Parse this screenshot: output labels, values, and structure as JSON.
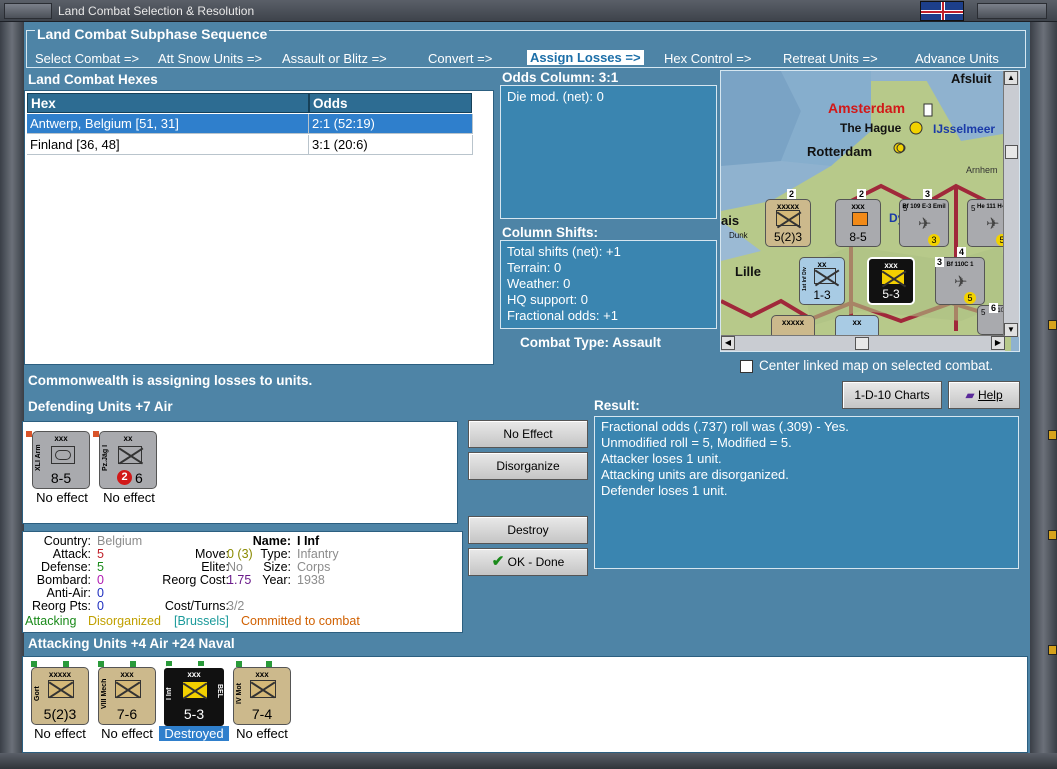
{
  "window": {
    "title": "Land Combat Selection & Resolution"
  },
  "subphase": {
    "label": "Land Combat Subphase Sequence",
    "steps": [
      {
        "label": "Select Combat =>"
      },
      {
        "label": "Att Snow Units =>"
      },
      {
        "label": "Assault or Blitz =>"
      },
      {
        "label": "Convert =>"
      },
      {
        "label": "Assign Losses =>",
        "active": true
      },
      {
        "label": "Hex Control =>"
      },
      {
        "label": "Retreat Units =>"
      },
      {
        "label": "Advance Units"
      }
    ]
  },
  "hexes": {
    "label": "Land Combat Hexes",
    "columns": [
      "Hex",
      "Odds"
    ],
    "rows": [
      {
        "hex": "Antwerp, Belgium [51, 31]",
        "odds": "2:1 (52:19)",
        "selected": true
      },
      {
        "hex": "Finland [36, 48]",
        "odds": "3:1 (20:6)"
      }
    ]
  },
  "odds": {
    "label": "Odds Column: 3:1",
    "lines": [
      "Die mod. (net): 0"
    ]
  },
  "shifts": {
    "label": "Column Shifts:",
    "lines": [
      "Total shifts (net): +1",
      "Terrain: 0",
      "Weather: 0",
      "HQ support: 0",
      "Fractional odds: +1"
    ]
  },
  "combat_type": "Combat Type:  Assault",
  "map": {
    "cities": {
      "afsluit": "Afsluit",
      "amsterdam": "Amsterdam",
      "hague": "The Hague",
      "ijsselmeer": "IJsselmeer",
      "rotterdam": "Rotterdam",
      "arnhem": "Arnhem",
      "lille": "Lille",
      "dunk": "Dunk",
      "ais": "ais",
      "dy": "Dy"
    },
    "center_checkbox": "Center linked map on selected combat.",
    "counters": {
      "gort_size": "xxxxx",
      "gort_str": "5(2)3",
      "gort_stack": "2",
      "xli_size": "xxx",
      "xli_str": "8-5",
      "xli_stack": "2",
      "bf109_name": "Bf 109 E-3 Emil",
      "bf109_str": "5",
      "bf109_stack": "3",
      "bf109_dot": "3",
      "he111_name": "He 111 H-2",
      "he111_str": "5",
      "he111_dot": "5",
      "inf1_size": "xx",
      "inf1_str": "1-3",
      "inf1_name": "1st Inf Div",
      "iinf_size": "xxx",
      "iinf_str": "5-3",
      "bf110_name": "Bf 110C 1",
      "bf110_dot": "5",
      "bf110_stack": "3",
      "bf110_stack2": "4",
      "bf109b_name": "Bf 109",
      "bf109b_str": "5",
      "b_size1": "xxxxx",
      "b_size2": "xx",
      "b_stack": "6"
    }
  },
  "status_message": "Commonwealth is assigning losses to units.",
  "defending": {
    "label": "Defending Units +7 Air",
    "units": [
      {
        "size": "xxx",
        "name": "XLI Arm",
        "strength": "8-5",
        "status": "No effect"
      },
      {
        "size": "xx",
        "name": "Pz.Jäg I",
        "strength": "6",
        "badge": "2",
        "status": "No effect"
      }
    ]
  },
  "unit_info": {
    "country_label": "Country:",
    "country": "Belgium",
    "attack_label": "Attack:",
    "attack": "5",
    "defense_label": "Defense:",
    "defense": "5",
    "bombard_label": "Bombard:",
    "bombard": "0",
    "antiair_label": "Anti-Air:",
    "antiair": "0",
    "reorgpts_label": "Reorg Pts:",
    "reorgpts": "0",
    "name_label": "Name:",
    "name": "I Inf",
    "move_label": "Move:",
    "move": "0 (3)",
    "elite_label": "Elite:",
    "elite": "No",
    "reorgcost_label": "Reorg Cost:",
    "reorgcost": "1.75",
    "costturns_label": "Cost/Turns:",
    "costturns": "3/2",
    "type_label": "Type:",
    "type": "Infantry",
    "size_label": "Size:",
    "size": "Corps",
    "year_label": "Year:",
    "year": "1938",
    "status_attacking": "Attacking",
    "status_disorganized": "Disorganized",
    "status_location": "[Brussels]",
    "status_committed": "Committed to combat"
  },
  "buttons": {
    "no_effect": "No Effect",
    "disorganize": "Disorganize",
    "destroy": "Destroy",
    "ok_done": "OK - Done",
    "charts": "1-D-10 Charts",
    "help": "Help"
  },
  "result": {
    "label": "Result:",
    "lines": [
      "Fractional odds (.737) roll was (.309)  - Yes.",
      "Unmodified roll = 5, Modified = 5.",
      "Attacker loses 1 unit.",
      "Attacking units are disorganized.",
      "Defender loses 1 unit."
    ]
  },
  "attacking": {
    "label": "Attacking Units +4 Air +24 Naval",
    "units": [
      {
        "size": "xxxxx",
        "name": "Gort",
        "strength": "5(2)3",
        "status": "No effect"
      },
      {
        "size": "xxx",
        "name": "VIII Mech",
        "strength": "7-6",
        "status": "No effect"
      },
      {
        "size": "xxx",
        "name": "I Inf",
        "nationality": "BEL",
        "strength": "5-3",
        "status": "Destroyed",
        "selected": true
      },
      {
        "size": "xxx",
        "name": "IV Mot",
        "strength": "7-4",
        "status": "No effect"
      }
    ]
  },
  "colors": {
    "background": "#4e84a6",
    "panel": "#3a85b0",
    "selection": "#2f7fcc",
    "header": "#2d6c92",
    "attack_value": "#c0202a",
    "defense_value": "#1a8a1a",
    "bombard_value": "#b01ab0",
    "antiair_value": "#2030c0",
    "disorganized": "#c0a000",
    "committed": "#d06000"
  }
}
